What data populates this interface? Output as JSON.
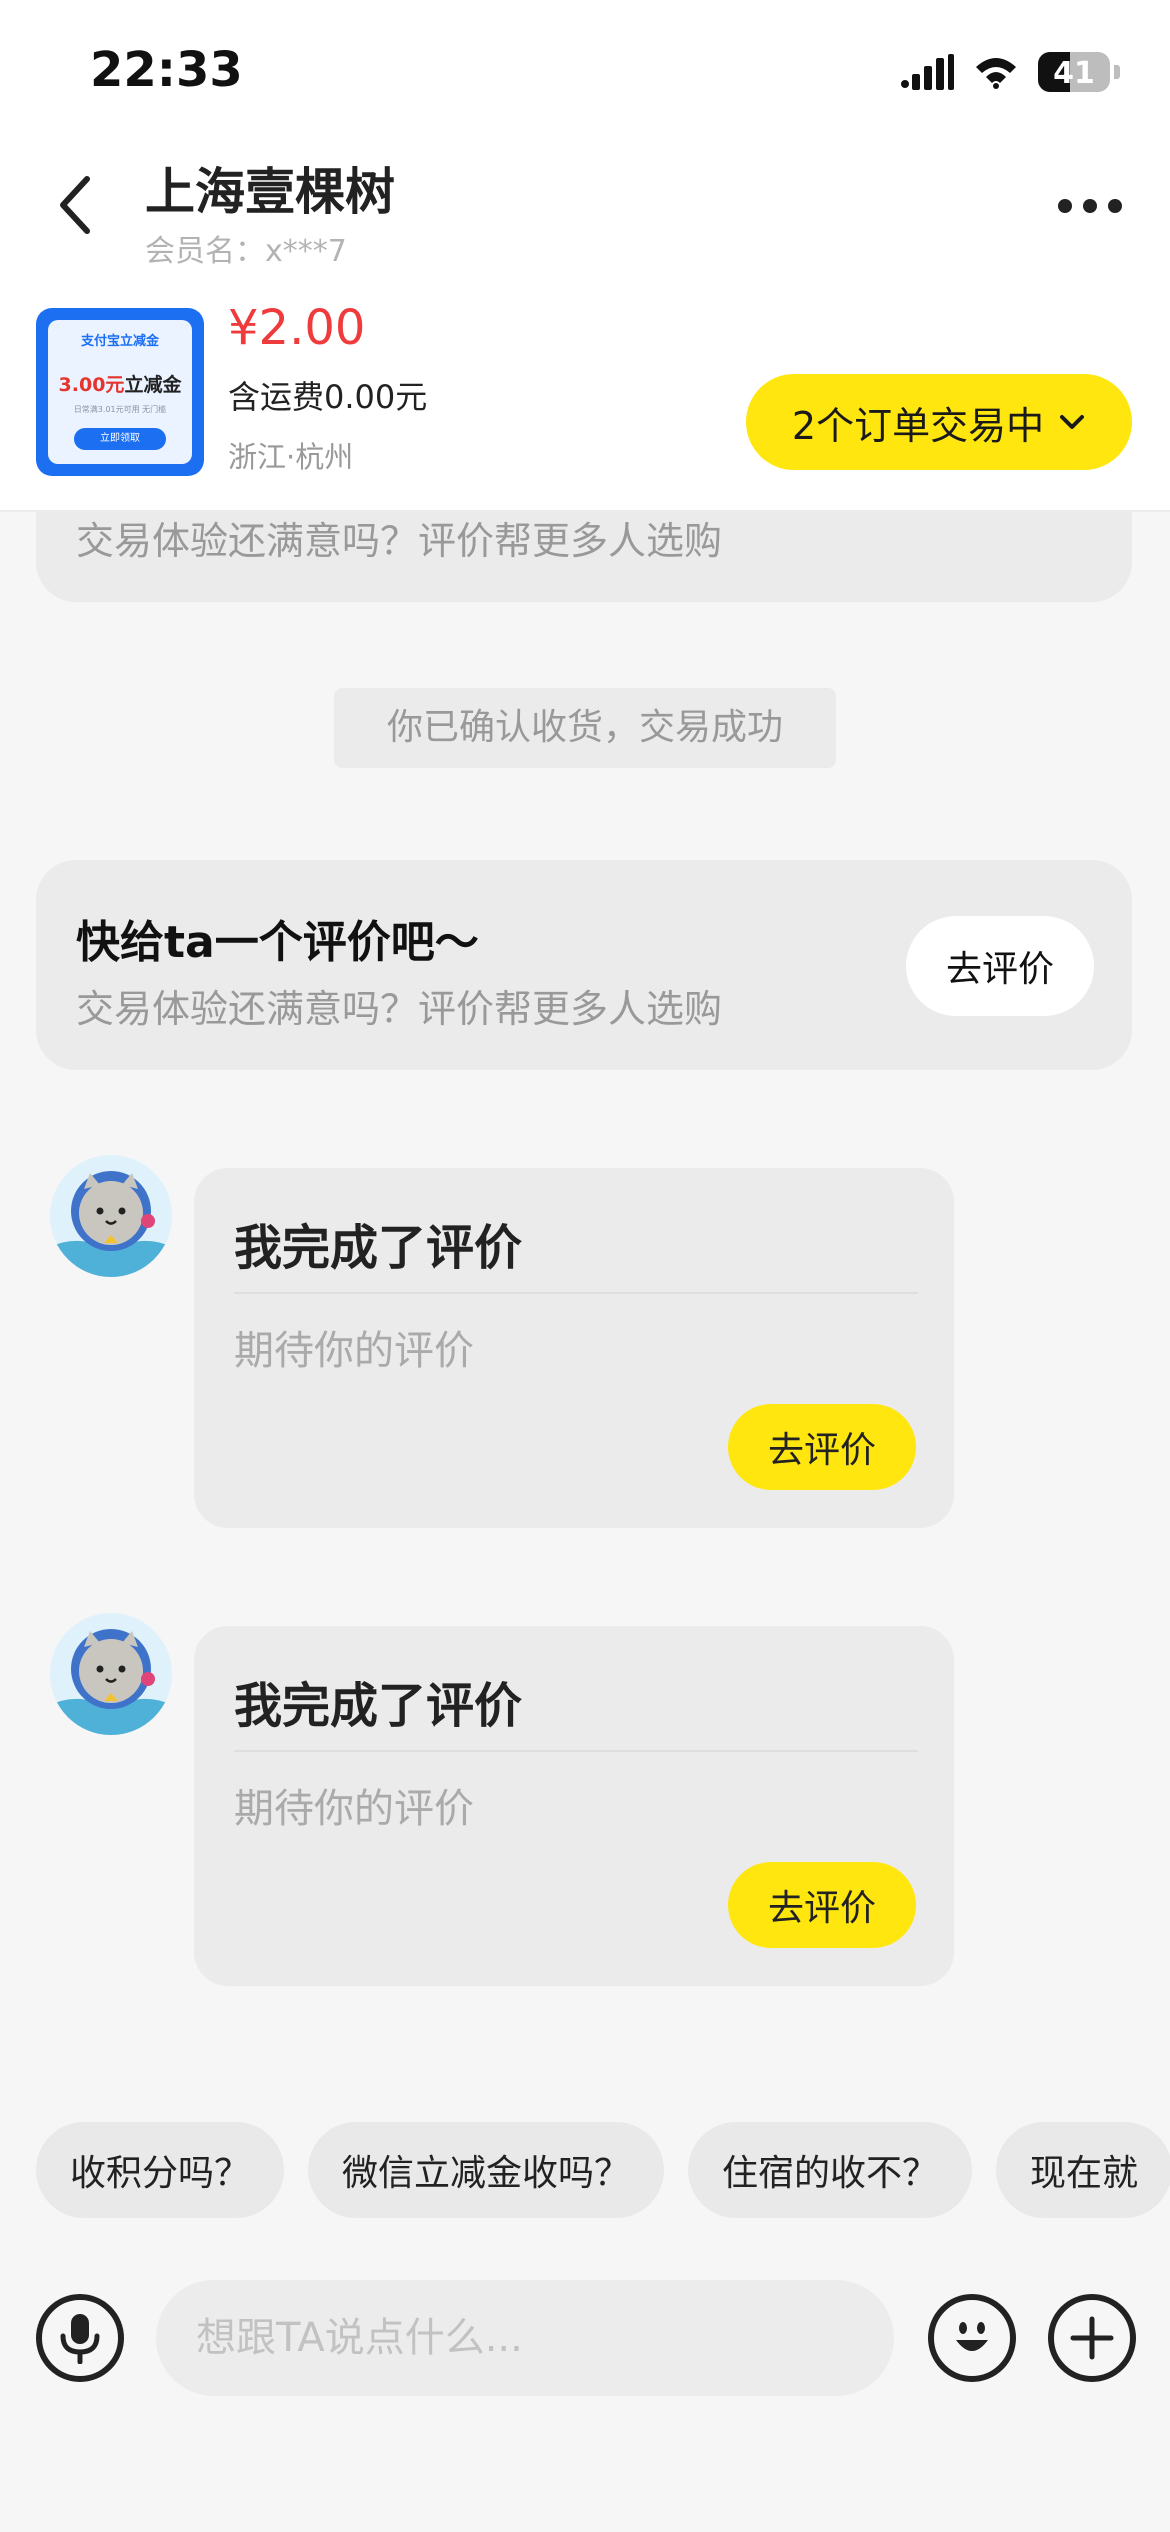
{
  "status_bar": {
    "time": "22:33",
    "battery": "41",
    "icons": [
      "signal-icon",
      "wifi-icon",
      "battery-icon"
    ]
  },
  "nav": {
    "title": "上海壹棵树",
    "member_name": "会员名：x***7",
    "back_icon": "chevron-left-icon",
    "more_icon": "more-icon"
  },
  "product": {
    "thumb": {
      "header": "支付宝立减金",
      "amount": "3.00元",
      "amount_suffix": "立减金",
      "note": "日常满3.01元可用 无门槛",
      "button": "立即领取"
    },
    "price": "¥2.00",
    "shipping": "含运费0.00元",
    "location": "浙江·杭州",
    "orders_button": "2个订单交易中"
  },
  "chat": {
    "top_card_desc": "交易体验还满意吗？评价帮更多人选购",
    "system_message": "你已确认收货，交易成功",
    "eval_card": {
      "title": "快给ta一个评价吧～",
      "desc": "交易体验还满意吗？评价帮更多人选购",
      "button": "去评价"
    },
    "messages": [
      {
        "title": "我完成了评价",
        "desc": "期待你的评价",
        "button": "去评价"
      },
      {
        "title": "我完成了评价",
        "desc": "期待你的评价",
        "button": "去评价"
      }
    ]
  },
  "quick_replies": [
    "收积分吗？",
    "微信立减金收吗？",
    "住宿的收不？",
    "现在就"
  ],
  "input_bar": {
    "placeholder": "想跟TA说点什么...",
    "voice_icon": "microphone-icon",
    "emoji_icon": "emoji-icon",
    "plus_icon": "plus-icon"
  },
  "colors": {
    "accent_yellow": "#ffe60f",
    "price_red": "#ef3b3b",
    "background": "#f6f6f6",
    "card_gray": "#ebebeb"
  }
}
